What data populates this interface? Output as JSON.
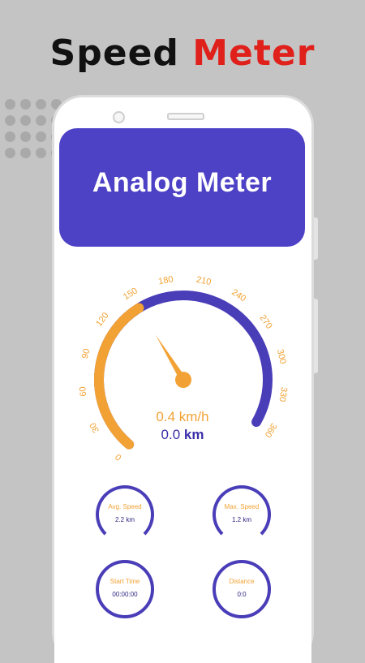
{
  "promo": {
    "word1": "Speed",
    "word2": "Meter",
    "word1_color": "#111111",
    "word2_color": "#e0201b"
  },
  "header": {
    "title": "Analog Meter",
    "background": "#4d41c6"
  },
  "gauge": {
    "min": 0,
    "max": 360,
    "value": 150,
    "ticks": [
      "0",
      "30",
      "60",
      "90",
      "120",
      "150",
      "180",
      "210",
      "240",
      "270",
      "300",
      "330",
      "360"
    ],
    "needle_value": 150,
    "active_color": "#f2a234",
    "track_color": "#4a3db8"
  },
  "readouts": {
    "speed": "0.4 km/h",
    "distance_value": "0.0",
    "distance_unit": "km"
  },
  "stats": [
    {
      "label": "Avg. Speed",
      "value": "2.2 km"
    },
    {
      "label": "Max. Speed",
      "value": "1.2 km"
    },
    {
      "label": "Start Time",
      "value": "00:00:00"
    },
    {
      "label": "Distance",
      "value": "0:0"
    }
  ]
}
